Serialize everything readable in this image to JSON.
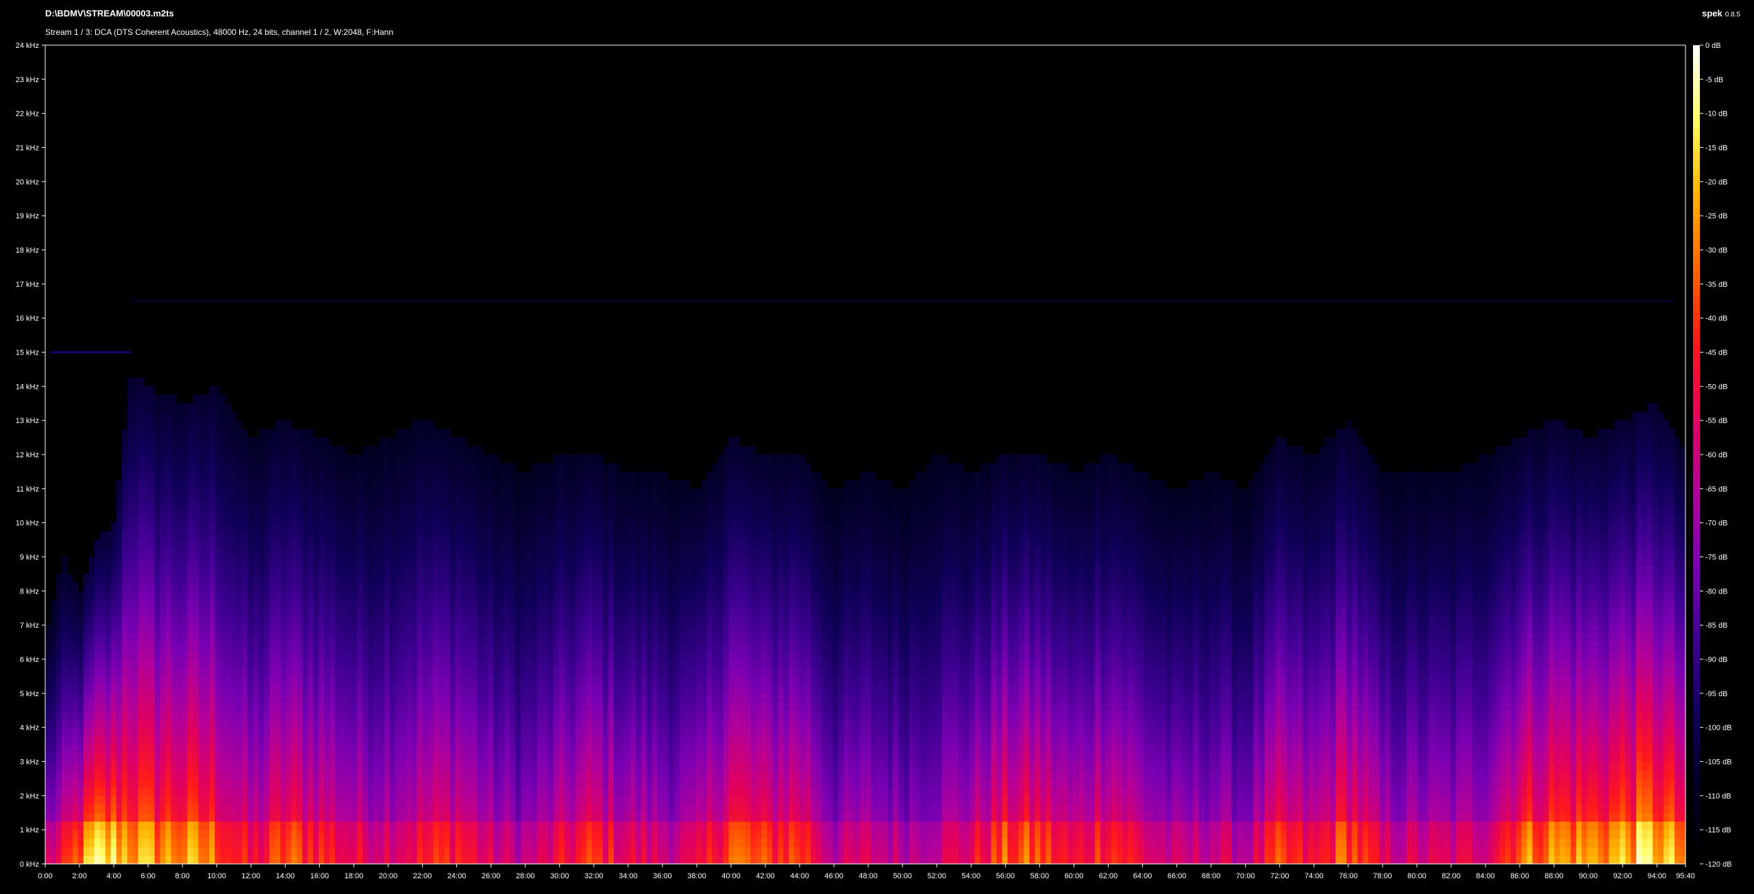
{
  "header": {
    "file_path": "D:\\BDMV\\STREAM\\00003.m2ts",
    "stream_info": "Stream 1 / 3: DCA (DTS Coherent Acoustics), 48000 Hz, 24 bits, channel 1 / 2, W:2048, F:Hann",
    "app_name": "spek",
    "app_version": "0.8.5"
  },
  "chart_data": {
    "type": "heatmap",
    "title": "",
    "x_ticks": [
      "0:00",
      "2:00",
      "4:00",
      "6:00",
      "8:00",
      "10:00",
      "12:00",
      "14:00",
      "16:00",
      "18:00",
      "20:00",
      "22:00",
      "24:00",
      "26:00",
      "28:00",
      "30:00",
      "32:00",
      "34:00",
      "36:00",
      "38:00",
      "40:00",
      "42:00",
      "44:00",
      "46:00",
      "48:00",
      "50:00",
      "52:00",
      "54:00",
      "56:00",
      "58:00",
      "60:00",
      "62:00",
      "64:00",
      "66:00",
      "68:00",
      "70:00",
      "72:00",
      "74:00",
      "76:00",
      "78:00",
      "80:00",
      "82:00",
      "84:00",
      "86:00",
      "88:00",
      "90:00",
      "92:00",
      "94:00",
      "95:40"
    ],
    "x_range_minutes": [
      0,
      95.667
    ],
    "y_ticks": [
      "0 kHz",
      "1 kHz",
      "2 kHz",
      "3 kHz",
      "4 kHz",
      "5 kHz",
      "6 kHz",
      "7 kHz",
      "8 kHz",
      "9 kHz",
      "10 kHz",
      "11 kHz",
      "12 kHz",
      "13 kHz",
      "14 kHz",
      "15 kHz",
      "16 kHz",
      "17 kHz",
      "18 kHz",
      "19 kHz",
      "20 kHz",
      "21 kHz",
      "22 kHz",
      "23 kHz",
      "24 kHz"
    ],
    "y_range_khz": [
      0,
      24
    ],
    "colorbar_ticks": [
      "0 dB",
      "-5 dB",
      "-10 dB",
      "-15 dB",
      "-20 dB",
      "-25 dB",
      "-30 dB",
      "-35 dB",
      "-40 dB",
      "-45 dB",
      "-50 dB",
      "-55 dB",
      "-60 dB",
      "-65 dB",
      "-70 dB",
      "-75 dB",
      "-80 dB",
      "-85 dB",
      "-90 dB",
      "-95 dB",
      "-100 dB",
      "-105 dB",
      "-110 dB",
      "-115 dB",
      "-120 dB"
    ],
    "colorbar_range_db": [
      -120,
      0
    ],
    "colormap": [
      "#000000",
      "#000022",
      "#11005a",
      "#3d0091",
      "#7a00b3",
      "#b3009a",
      "#e1005e",
      "#ff1a1a",
      "#ff6600",
      "#ffb300",
      "#ffff66",
      "#ffffff"
    ],
    "frame_color": "#ffffff",
    "energy_profile": [
      {
        "t": 0.0,
        "top_khz": 6.5,
        "level": 0.55
      },
      {
        "t": 1.0,
        "top_khz": 9.0,
        "level": 0.6
      },
      {
        "t": 2.0,
        "top_khz": 8.0,
        "level": 0.8
      },
      {
        "t": 3.0,
        "top_khz": 9.5,
        "level": 0.95
      },
      {
        "t": 4.0,
        "top_khz": 10.0,
        "level": 0.95
      },
      {
        "t": 5.0,
        "top_khz": 14.5,
        "level": 0.9
      },
      {
        "t": 6.0,
        "top_khz": 14.0,
        "level": 0.85
      },
      {
        "t": 8.0,
        "top_khz": 13.5,
        "level": 0.85
      },
      {
        "t": 10.0,
        "top_khz": 14.0,
        "level": 0.8
      },
      {
        "t": 12.0,
        "top_khz": 12.5,
        "level": 0.6
      },
      {
        "t": 14.0,
        "top_khz": 13.0,
        "level": 0.75
      },
      {
        "t": 16.0,
        "top_khz": 12.5,
        "level": 0.7
      },
      {
        "t": 18.0,
        "top_khz": 12.0,
        "level": 0.6
      },
      {
        "t": 20.0,
        "top_khz": 12.5,
        "level": 0.6
      },
      {
        "t": 22.0,
        "top_khz": 13.0,
        "level": 0.65
      },
      {
        "t": 24.0,
        "top_khz": 12.5,
        "level": 0.7
      },
      {
        "t": 26.0,
        "top_khz": 12.0,
        "level": 0.55
      },
      {
        "t": 28.0,
        "top_khz": 11.5,
        "level": 0.5
      },
      {
        "t": 30.0,
        "top_khz": 12.0,
        "level": 0.6
      },
      {
        "t": 32.0,
        "top_khz": 12.0,
        "level": 0.7
      },
      {
        "t": 34.0,
        "top_khz": 11.5,
        "level": 0.6
      },
      {
        "t": 36.0,
        "top_khz": 11.5,
        "level": 0.55
      },
      {
        "t": 38.0,
        "top_khz": 11.0,
        "level": 0.55
      },
      {
        "t": 40.0,
        "top_khz": 12.5,
        "level": 0.8
      },
      {
        "t": 42.0,
        "top_khz": 12.0,
        "level": 0.7
      },
      {
        "t": 44.0,
        "top_khz": 12.0,
        "level": 0.75
      },
      {
        "t": 46.0,
        "top_khz": 11.0,
        "level": 0.5
      },
      {
        "t": 48.0,
        "top_khz": 11.5,
        "level": 0.55
      },
      {
        "t": 50.0,
        "top_khz": 11.0,
        "level": 0.5
      },
      {
        "t": 52.0,
        "top_khz": 12.0,
        "level": 0.55
      },
      {
        "t": 54.0,
        "top_khz": 11.5,
        "level": 0.6
      },
      {
        "t": 56.0,
        "top_khz": 12.0,
        "level": 0.75
      },
      {
        "t": 58.0,
        "top_khz": 12.0,
        "level": 0.75
      },
      {
        "t": 60.0,
        "top_khz": 11.5,
        "level": 0.6
      },
      {
        "t": 62.0,
        "top_khz": 12.0,
        "level": 0.75
      },
      {
        "t": 64.0,
        "top_khz": 11.5,
        "level": 0.6
      },
      {
        "t": 66.0,
        "top_khz": 11.0,
        "level": 0.5
      },
      {
        "t": 68.0,
        "top_khz": 11.5,
        "level": 0.55
      },
      {
        "t": 70.0,
        "top_khz": 11.0,
        "level": 0.5
      },
      {
        "t": 72.0,
        "top_khz": 12.5,
        "level": 0.7
      },
      {
        "t": 74.0,
        "top_khz": 12.0,
        "level": 0.6
      },
      {
        "t": 76.0,
        "top_khz": 13.0,
        "level": 0.8
      },
      {
        "t": 78.0,
        "top_khz": 11.5,
        "level": 0.55
      },
      {
        "t": 80.0,
        "top_khz": 11.5,
        "level": 0.55
      },
      {
        "t": 82.0,
        "top_khz": 11.5,
        "level": 0.55
      },
      {
        "t": 84.0,
        "top_khz": 12.0,
        "level": 0.6
      },
      {
        "t": 86.0,
        "top_khz": 12.5,
        "level": 0.8
      },
      {
        "t": 88.0,
        "top_khz": 13.0,
        "level": 0.85
      },
      {
        "t": 90.0,
        "top_khz": 12.5,
        "level": 0.85
      },
      {
        "t": 92.0,
        "top_khz": 13.0,
        "level": 0.9
      },
      {
        "t": 94.0,
        "top_khz": 13.5,
        "level": 0.95
      },
      {
        "t": 95.67,
        "top_khz": 12.0,
        "level": 0.8
      }
    ],
    "tone_lines": [
      {
        "khz": 15.0,
        "from_min": 0.3,
        "to_min": 5.0,
        "db": -95
      },
      {
        "khz": 16.5,
        "from_min": 5.0,
        "to_min": 95.0,
        "db": -108
      }
    ]
  }
}
